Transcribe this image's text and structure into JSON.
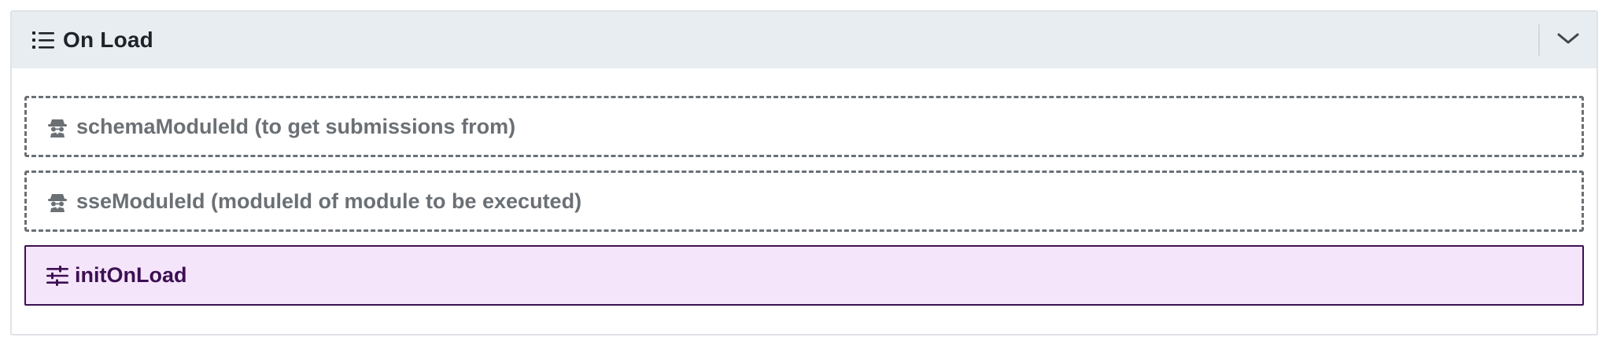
{
  "panel": {
    "title": "On Load",
    "title_icon": "list-icon",
    "toggle_icon": "chevron-down-icon"
  },
  "rows": [
    {
      "label": "schemaModuleId (to get submissions from)",
      "icon": "incognito-icon",
      "style": "dashed-placeholder"
    },
    {
      "label": "sseModuleId (moduleId of module to be executed)",
      "icon": "incognito-icon",
      "style": "dashed-placeholder"
    },
    {
      "label": "initOnLoad",
      "icon": "sliders-icon",
      "style": "function"
    }
  ],
  "colors": {
    "header_bg": "#e8edf2",
    "placeholder_text": "#6b7075",
    "function_bg": "#f5e5fb",
    "function_border": "#3c1053"
  }
}
